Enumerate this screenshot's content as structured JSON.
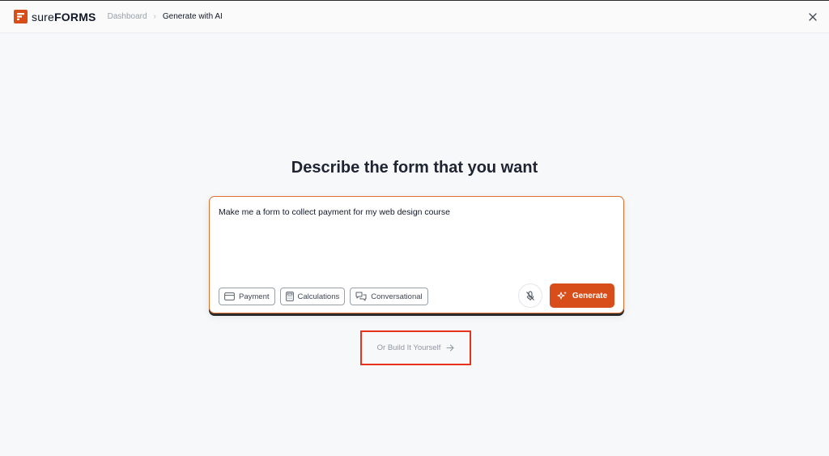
{
  "header": {
    "logo_sure": "sure",
    "logo_forms": "FORMS",
    "breadcrumb": [
      "Dashboard",
      "Generate with AI"
    ]
  },
  "main": {
    "heading": "Describe the form that you want",
    "prompt_value": "Make me a form to collect payment for my web design course",
    "chips": [
      {
        "label": "Payment",
        "icon": "credit-card-icon"
      },
      {
        "label": "Calculations",
        "icon": "calculator-icon"
      },
      {
        "label": "Conversational",
        "icon": "chat-bubbles-icon"
      }
    ],
    "generate_label": "Generate",
    "build_yourself_label": "Or Build It Yourself"
  },
  "colors": {
    "accent": "#d84e1b",
    "highlight_box": "#e8321e"
  }
}
